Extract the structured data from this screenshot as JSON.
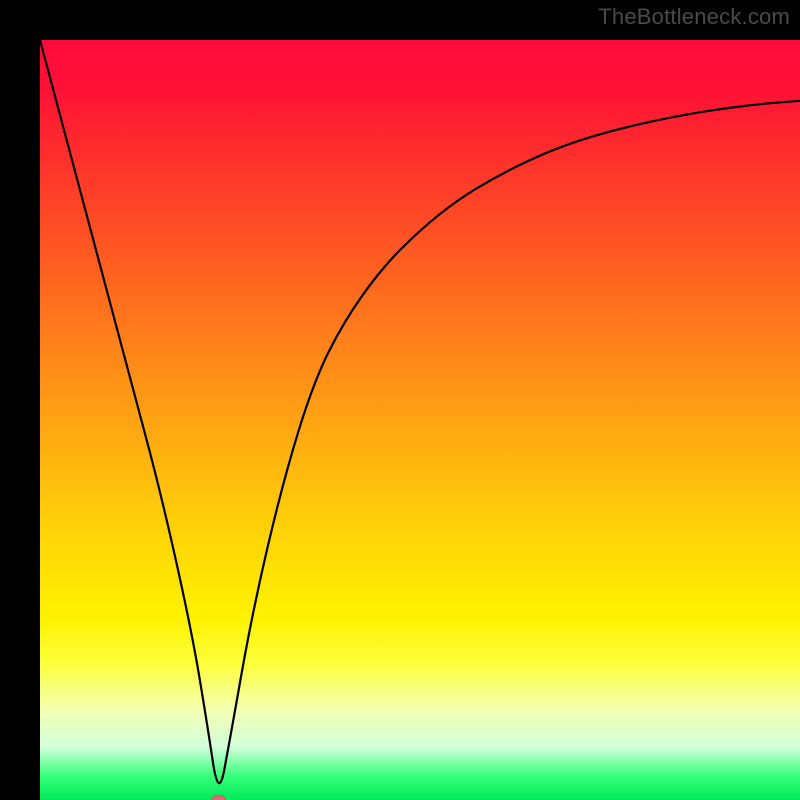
{
  "watermark": {
    "text": "TheBottleneck.com"
  },
  "chart_data": {
    "type": "line",
    "title": "",
    "xlabel": "",
    "ylabel": "",
    "xlim": [
      0,
      100
    ],
    "ylim": [
      0,
      100
    ],
    "grid": false,
    "legend": false,
    "background_gradient": {
      "direction": "vertical",
      "stops": [
        {
          "pos": 0,
          "color": "#ff0a3a"
        },
        {
          "pos": 50,
          "color": "#ffa313"
        },
        {
          "pos": 80,
          "color": "#fff200"
        },
        {
          "pos": 100,
          "color": "#00e85a"
        }
      ]
    },
    "series": [
      {
        "name": "bottleneck-curve",
        "color": "#000000",
        "x": [
          0,
          4,
          8,
          12,
          16,
          20,
          22,
          23.5,
          25,
          28,
          32,
          36,
          40,
          45,
          50,
          55,
          60,
          65,
          70,
          75,
          80,
          85,
          90,
          95,
          100
        ],
        "y": [
          100,
          85,
          70,
          55,
          40,
          22,
          10,
          0,
          8,
          25,
          42,
          55,
          63,
          70,
          75,
          79,
          82,
          84.5,
          86.5,
          88,
          89.2,
          90.2,
          91,
          91.6,
          92
        ]
      }
    ],
    "marker": {
      "name": "optimal-point",
      "x": 23.5,
      "y": 0,
      "color": "#d66f74",
      "rx": 7,
      "ry": 5
    }
  }
}
